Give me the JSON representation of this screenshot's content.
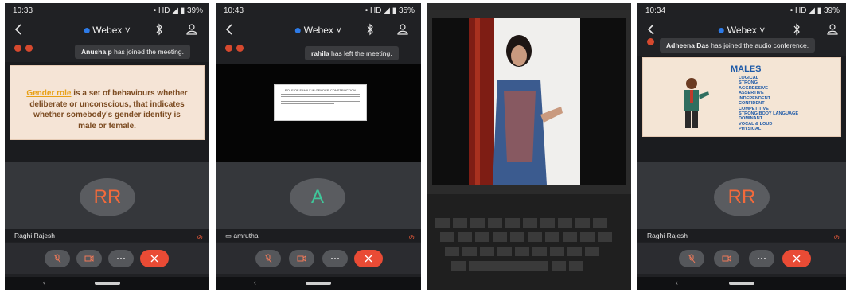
{
  "panels": [
    {
      "status_time": "10:33",
      "status_indicators": "• HD ◢ ▮ 39%",
      "app_title": "Webex ˅",
      "toast_name": "Anusha p",
      "toast_msg": " has joined the meeting.",
      "slide_highlight": "Gender role",
      "slide_text": " is a set of behaviours whether deliberate or unconscious, that indicates whether somebody's gender identity is male or female.",
      "avatar": "RR",
      "name": "Raghi Rajesh"
    },
    {
      "status_time": "10:43",
      "status_indicators": "• HD ◢ ▮ 35%",
      "app_title": "Webex ˅",
      "toast_name": "rahila",
      "toast_msg": " has left the meeting.",
      "doc_title": "ROLE OF FAMILY IN GENDER CONSTRUCTION",
      "avatar": "A",
      "name": "amrutha"
    },
    {
      "photo": "laptop-screen-speaker"
    },
    {
      "status_time": "10:34",
      "status_indicators": "• HD ◢ ▮ 39%",
      "app_title": "Webex ˅",
      "toast_name": "Adheena Das",
      "toast_msg": " has joined the audio conference.",
      "slide_title": "MALES",
      "traits": [
        "LOGICAL",
        "STRONG",
        "AGGRESSIVE",
        "ASSERTIVE",
        "INDEPENDENT",
        "CONFIDENT",
        "COMPETITIVE",
        "STRONG BODY LANGUAGE",
        "DOMINANT",
        "VOCAL & LOUD",
        "PHYSICAL"
      ],
      "avatar": "RR",
      "name": "Raghi Rajesh"
    }
  ],
  "colors": {
    "webex_blue": "#2d7be8",
    "end_red": "#e94b35",
    "avatar_orange": "#f36a3b",
    "avatar_green": "#3fc79a"
  }
}
